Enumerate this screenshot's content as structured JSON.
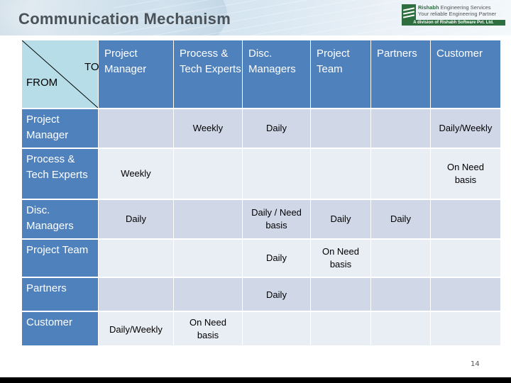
{
  "slide": {
    "title": "Communication Mechanism",
    "page_number": "14"
  },
  "logo": {
    "name_bold": "Rishabh",
    "name_rest": " Engineering Services",
    "tagline": "Your reliable Engineering Partner",
    "division": "A division of Rishabh Software Pvt. Ltd."
  },
  "matrix": {
    "corner_to": "TO",
    "corner_from": "FROM",
    "columns": [
      "Project Manager",
      "Process & Tech Experts",
      "Disc. Managers",
      "Project Team",
      "Partners",
      "Customer"
    ],
    "rows": [
      {
        "label": "Project Manager",
        "cells": [
          "",
          "Weekly",
          "Daily",
          "",
          "",
          "Daily/Weekly"
        ]
      },
      {
        "label": "Process & Tech Experts",
        "cells": [
          "Weekly",
          "",
          "",
          "",
          "",
          "On Need basis"
        ]
      },
      {
        "label": "Disc. Managers",
        "cells": [
          "Daily",
          "",
          "Daily / Need basis",
          "Daily",
          "Daily",
          ""
        ]
      },
      {
        "label": "Project Team",
        "cells": [
          "",
          "",
          "Daily",
          "On Need basis",
          "",
          ""
        ]
      },
      {
        "label": "Partners",
        "cells": [
          "",
          "",
          "Daily",
          "",
          "",
          ""
        ]
      },
      {
        "label": "Customer",
        "cells": [
          "Daily/Weekly",
          "On Need basis",
          "",
          "",
          "",
          ""
        ]
      }
    ]
  },
  "colors": {
    "header_blue": "#4f81bd",
    "corner_light_blue": "#b7dde8",
    "band_dark": "#d0d8e8",
    "band_light": "#e9edf4"
  }
}
